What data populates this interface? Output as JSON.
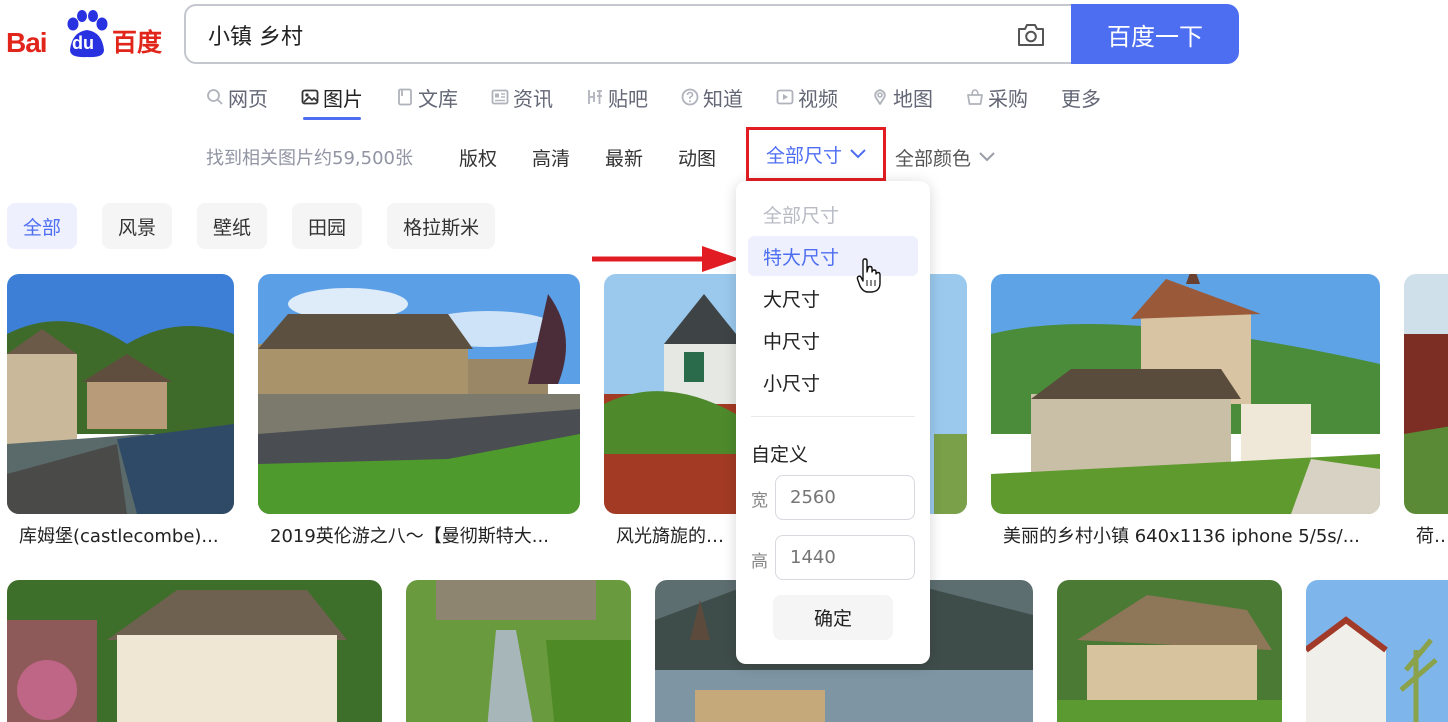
{
  "logo": {
    "bai": "Bai",
    "du": "du",
    "cn": "百度"
  },
  "search": {
    "query": "小镇 乡村",
    "button": "百度一下"
  },
  "nav": [
    {
      "label": "网页",
      "icon": "search-icon"
    },
    {
      "label": "图片",
      "icon": "image-icon",
      "active": true
    },
    {
      "label": "文库",
      "icon": "doc-icon"
    },
    {
      "label": "资讯",
      "icon": "news-icon"
    },
    {
      "label": "贴吧",
      "icon": "tieba-icon"
    },
    {
      "label": "知道",
      "icon": "question-icon"
    },
    {
      "label": "视频",
      "icon": "video-icon"
    },
    {
      "label": "地图",
      "icon": "map-pin-icon"
    },
    {
      "label": "采购",
      "icon": "basket-icon"
    },
    {
      "label": "更多",
      "icon": ""
    }
  ],
  "filters": {
    "result_count": "找到相关图片约59,500张",
    "items": [
      "版权",
      "高清",
      "最新",
      "动图"
    ],
    "size": "全部尺寸",
    "color": "全部颜色"
  },
  "chips": [
    "全部",
    "风景",
    "壁纸",
    "田园",
    "格拉斯米"
  ],
  "images_row1": [
    {
      "caption": "库姆堡(castlecombe)..."
    },
    {
      "caption": "2019英伦游之八～【曼彻斯特大..."
    },
    {
      "caption": "风光旖旎的奥..."
    },
    {
      "caption": "美丽的乡村小镇 640x1136 iphone 5/5s/..."
    },
    {
      "caption": "荷兰"
    }
  ],
  "size_dropdown": {
    "options": [
      "全部尺寸",
      "特大尺寸",
      "大尺寸",
      "中尺寸",
      "小尺寸"
    ],
    "custom_label": "自定义",
    "width_label": "宽",
    "width_placeholder": "2560",
    "height_label": "高",
    "height_placeholder": "1440",
    "confirm": "确定"
  },
  "colors": {
    "accent": "#4e6ef2",
    "highlight_box": "#e11d23",
    "logo_red": "#e1251b"
  }
}
